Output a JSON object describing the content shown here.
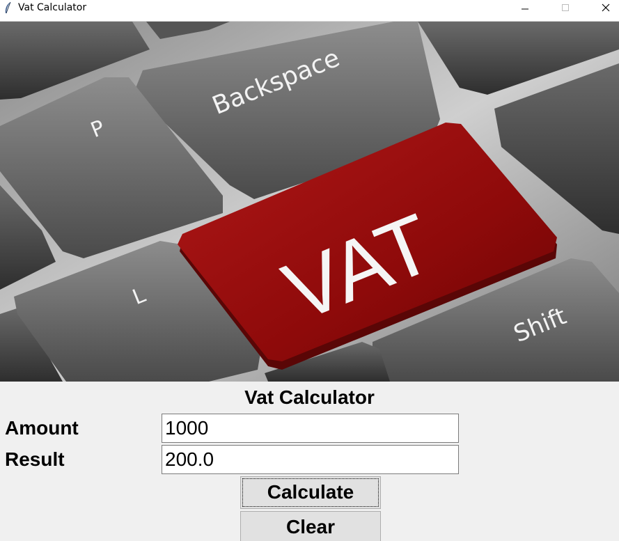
{
  "window": {
    "title": "Vat Calculator",
    "icon": "feather-icon",
    "controls": [
      "minimize-icon",
      "maximize-icon",
      "close-icon"
    ]
  },
  "banner": {
    "keys": {
      "backspace": "Backspace",
      "p": "P",
      "vat": "VAT",
      "l": "L",
      "shift": "Shift"
    },
    "colors": {
      "vat_key": "#9b0c0c",
      "keys": "#5a5a5a"
    }
  },
  "form": {
    "heading": "Vat Calculator",
    "amount_label": "Amount",
    "amount_value": "1000",
    "result_label": "Result",
    "result_value": "200.0",
    "calculate_label": "Calculate",
    "clear_label": "Clear"
  }
}
